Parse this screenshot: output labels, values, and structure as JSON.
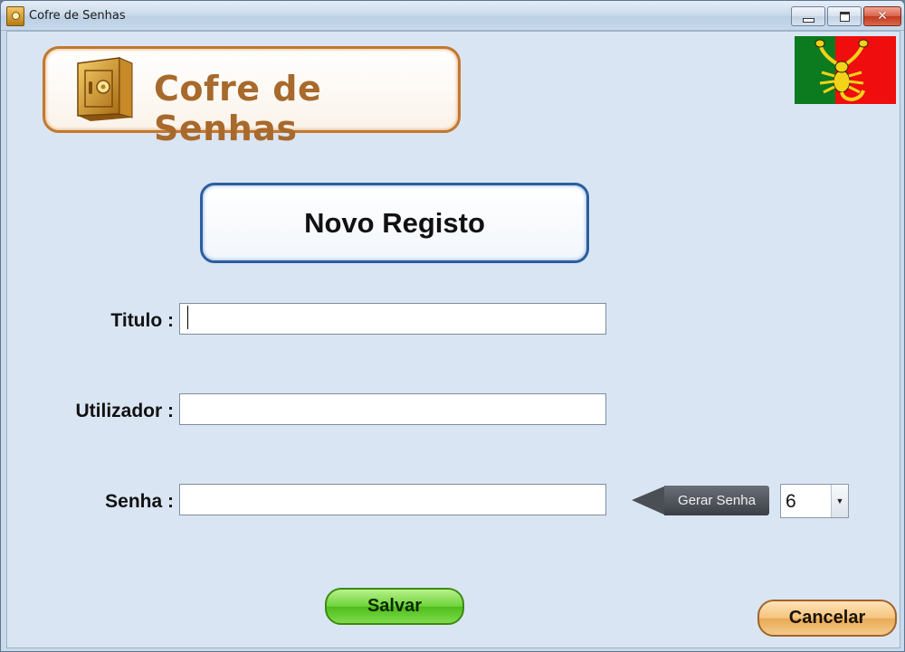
{
  "window": {
    "title": "Cofre de Senhas",
    "close_glyph": "✕"
  },
  "logo": {
    "text": "Cofre de Senhas",
    "icon": "safe-icon"
  },
  "flag": {
    "icon": "scorpion-flag-icon",
    "colors": [
      "#0c7a1e",
      "#ef0d0d",
      "#f3d21a"
    ]
  },
  "form": {
    "header": "Novo Registo",
    "titulo_label": "Titulo :",
    "titulo_value": "",
    "utilizador_label": "Utilizador :",
    "utilizador_value": "",
    "senha_label": "Senha :",
    "senha_value": "",
    "generate_label": "Gerar Senha",
    "length_value": "6"
  },
  "actions": {
    "save_label": "Salvar",
    "cancel_label": "Cancelar"
  },
  "colors": {
    "background": "#d9e5f2",
    "save_button": "#6fd33c",
    "cancel_button": "#f4c47e",
    "header_border": "#2a5e9f",
    "logo_border": "#c27830"
  }
}
